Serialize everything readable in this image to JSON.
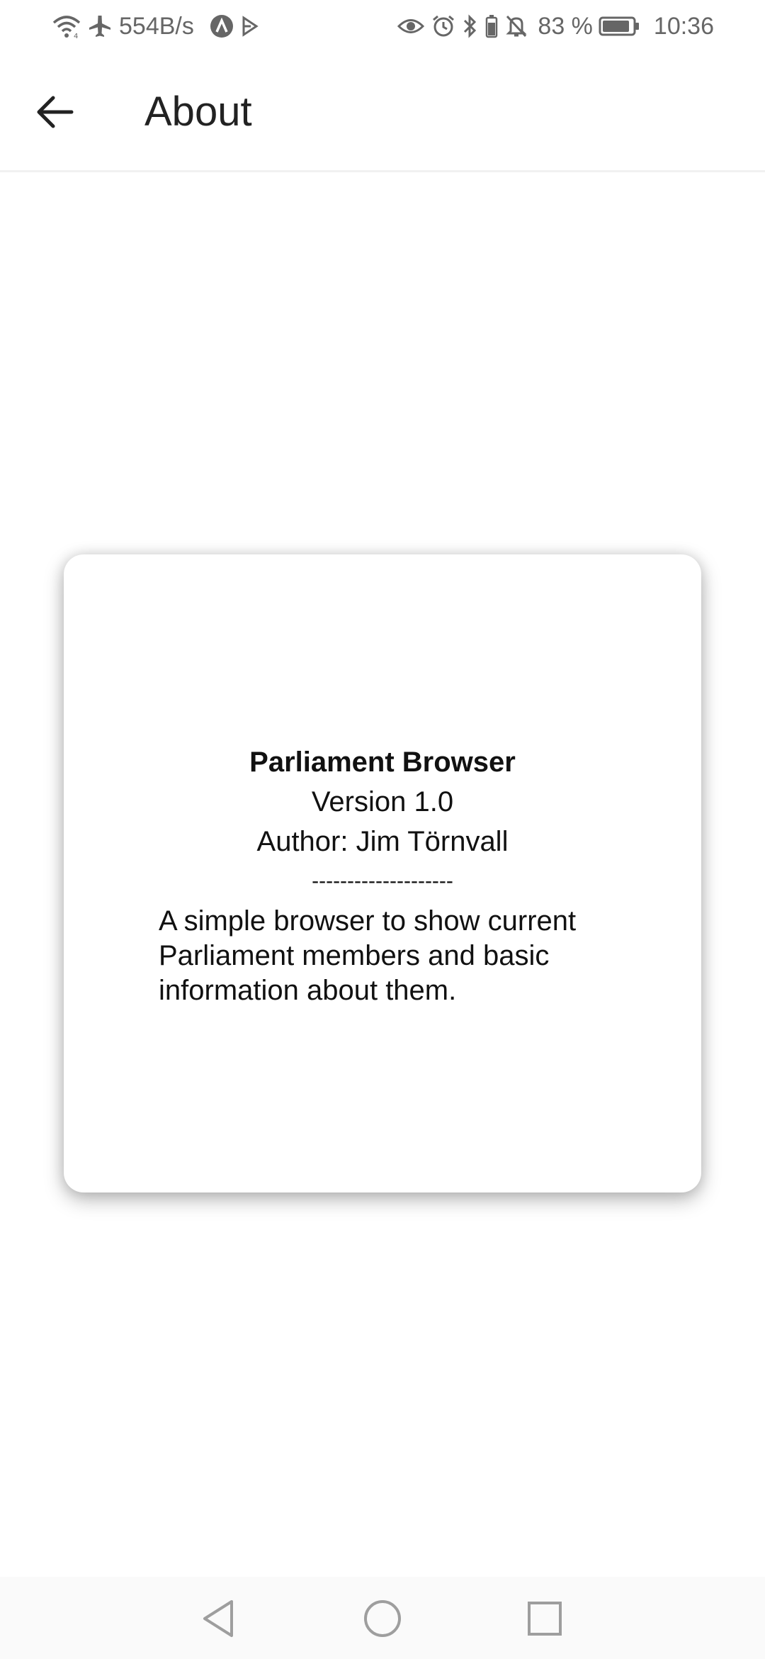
{
  "status_bar": {
    "net_speed": "554B/s",
    "battery_percent": "83 %",
    "time": "10:36",
    "icons_left": [
      "wifi-icon",
      "airplane-icon",
      "app-a-icon",
      "play-icon"
    ],
    "icons_right": [
      "eye-icon",
      "alarm-icon",
      "bluetooth-icon",
      "battery-small-icon",
      "mute-icon",
      "battery-icon"
    ]
  },
  "app_bar": {
    "title": "About",
    "back_icon": "arrow-left-icon"
  },
  "about_card": {
    "app_name": "Parliament Browser",
    "version": "Version 1.0",
    "author": "Author: Jim Törnvall",
    "divider": "--------------------",
    "description": "A simple browser to show current Parliament members and basic information about them."
  },
  "nav_bar": {
    "buttons": [
      "back-triangle-icon",
      "home-circle-icon",
      "recents-square-icon"
    ]
  },
  "colors": {
    "background": "#ffffff",
    "text_primary": "#111111",
    "status_text": "#666666",
    "nav_icon": "#9e9e9e"
  }
}
